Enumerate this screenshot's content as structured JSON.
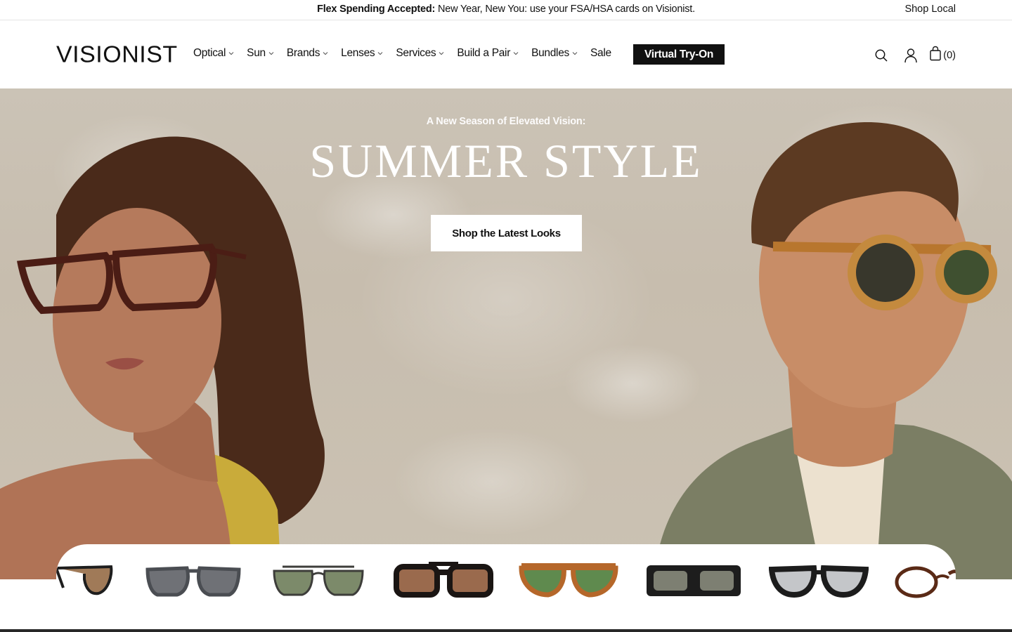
{
  "announcement": {
    "bold": "Flex Spending Accepted:",
    "text": " New Year, New You: use your FSA/HSA cards on Visionist.",
    "right_link": "Shop Local"
  },
  "header": {
    "logo": "VISIONIST",
    "nav": [
      {
        "label": "Optical",
        "has_dropdown": true
      },
      {
        "label": "Sun",
        "has_dropdown": true
      },
      {
        "label": "Brands",
        "has_dropdown": true
      },
      {
        "label": "Lenses",
        "has_dropdown": true
      },
      {
        "label": "Services",
        "has_dropdown": true
      },
      {
        "label": "Build a Pair",
        "has_dropdown": true
      },
      {
        "label": "Bundles",
        "has_dropdown": true
      },
      {
        "label": "Sale",
        "has_dropdown": false
      }
    ],
    "try_on_label": "Virtual Try-On",
    "icons": [
      "search-icon",
      "account-icon",
      "bag-icon"
    ],
    "cart_count": "(0)"
  },
  "hero": {
    "eyebrow": "A New Season of Elevated Vision:",
    "title": "SUMMER STYLE",
    "cta": "Shop the Latest Looks"
  },
  "product_strip": {
    "items": [
      {
        "kind": "cat-eye sunglasses",
        "frame_color": "#1e1e1e",
        "lens_color": "#a07a58"
      },
      {
        "kind": "rectangular sunglasses",
        "frame_color": "#4a4d52",
        "lens_color": "#6f7176"
      },
      {
        "kind": "double-bridge aviators",
        "frame_color": "#3d3d3a",
        "lens_color": "#7c8a6a"
      },
      {
        "kind": "square sunglasses",
        "frame_color": "#1a1513",
        "lens_color": "#9a6a4d"
      },
      {
        "kind": "tortoise aviators",
        "frame_color": "#b5672a",
        "lens_color": "#5f8a4e"
      },
      {
        "kind": "wide rectangle sunglasses",
        "frame_color": "#1d1d1d",
        "lens_color": "#7d7f72"
      },
      {
        "kind": "round sunglasses",
        "frame_color": "#1c1c1c",
        "lens_color": "#c4c6c9"
      },
      {
        "kind": "round optical",
        "frame_color": "#5a2a16",
        "lens_color": "#ffffff"
      }
    ]
  },
  "colors": {
    "accent": "#111111",
    "hero_background": "#c9c0b1"
  }
}
